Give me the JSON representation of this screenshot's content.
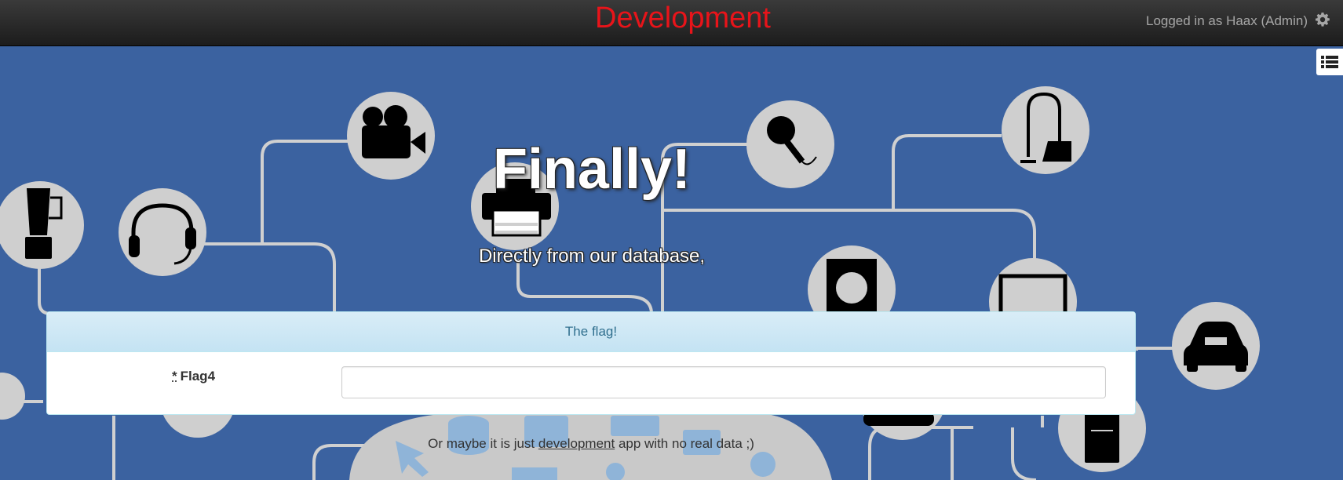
{
  "header": {
    "brand": "Development",
    "user_text": "Logged in as Haax (Admin)",
    "brand_color": "#e8141a"
  },
  "icons": {
    "settings": "gear-icon",
    "side_toggle": "list-icon"
  },
  "hero": {
    "title": "Finally!",
    "subtitle": "Directly from our database,"
  },
  "panel": {
    "heading": "The flag!",
    "required_mark": "*",
    "field_label": "Flag4",
    "field_value": ""
  },
  "footer": {
    "before": "Or maybe it is just ",
    "link": "development",
    "after": " app with no real data ;)"
  }
}
